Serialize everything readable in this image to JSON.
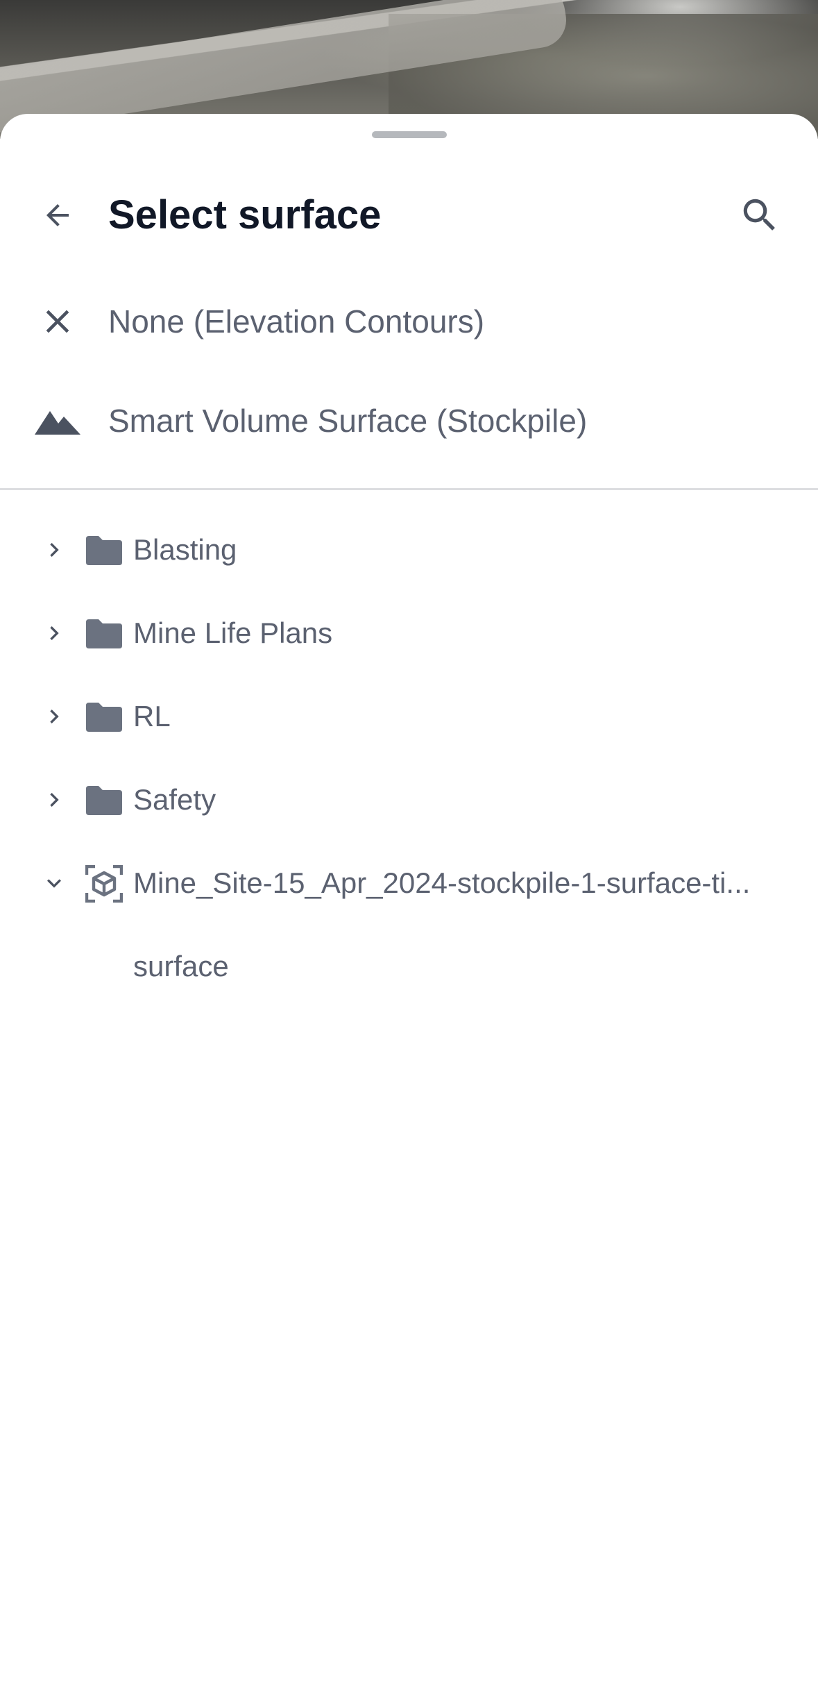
{
  "sheet": {
    "title": "Select surface"
  },
  "header": {
    "back_icon": "arrow-left-icon",
    "search_icon": "search-icon"
  },
  "options": [
    {
      "label": "None (Elevation Contours)",
      "icon": "close-icon"
    },
    {
      "label": "Smart Volume Surface (Stockpile)",
      "icon": "mountain-icon"
    }
  ],
  "tree": [
    {
      "label": "Blasting",
      "icon": "folder-icon",
      "expanded": false
    },
    {
      "label": "Mine Life Plans",
      "icon": "folder-icon",
      "expanded": false
    },
    {
      "label": "RL",
      "icon": "folder-icon",
      "expanded": false
    },
    {
      "label": "Safety",
      "icon": "folder-icon",
      "expanded": false
    },
    {
      "label": "Mine_Site-15_Apr_2024-stockpile-1-surface-ti...",
      "icon": "3d-model-icon",
      "expanded": true
    }
  ],
  "tree_children": [
    {
      "label": "surface"
    }
  ],
  "colors": {
    "title": "#111827",
    "text": "#5b6170",
    "icon": "#6b7280",
    "divider": "#dcdde0",
    "handle": "#b5b8bc"
  }
}
